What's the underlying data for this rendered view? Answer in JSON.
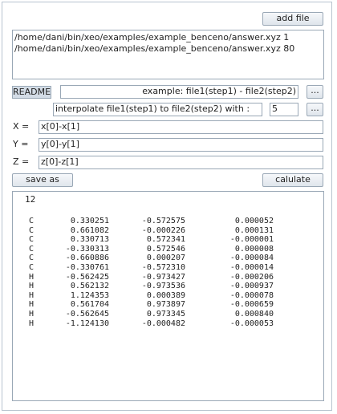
{
  "buttons": {
    "add_file": "add file",
    "readme": "README",
    "browse1": "...",
    "browse2": "...",
    "save_as": "save as",
    "calculate": "calulate"
  },
  "files": [
    "/home/dani/bin/xeo/examples/example_benceno/answer.xyz 1",
    "/home/dani/bin/xeo/examples/example_benceno/answer.xyz 80"
  ],
  "example_field": "example:  file1(step1) - file2(step2)",
  "interpolate_label": "interpolate   file1(step1) to file2(step2) with :",
  "interpolate_value": "5",
  "expressions": {
    "x_label": "X =",
    "x_value": "x[0]-x[1]",
    "y_label": "Y =",
    "y_value": "y[0]-y[1]",
    "z_label": "Z =",
    "z_value": "z[0]-z[1]"
  },
  "output": {
    "count": "12",
    "atoms": [
      {
        "el": "C",
        "x": "0.330251",
        "y": "-0.572575",
        "z": "0.000052"
      },
      {
        "el": "C",
        "x": "0.661082",
        "y": "-0.000226",
        "z": "0.000131"
      },
      {
        "el": "C",
        "x": "0.330713",
        "y": "0.572341",
        "z": "-0.000001"
      },
      {
        "el": "C",
        "x": "-0.330313",
        "y": "0.572546",
        "z": "0.000008"
      },
      {
        "el": "C",
        "x": "-0.660886",
        "y": "0.000207",
        "z": "-0.000084"
      },
      {
        "el": "C",
        "x": "-0.330761",
        "y": "-0.572310",
        "z": "-0.000014"
      },
      {
        "el": "H",
        "x": "-0.562425",
        "y": "-0.973427",
        "z": "-0.000206"
      },
      {
        "el": "H",
        "x": "0.562132",
        "y": "-0.973536",
        "z": "-0.000937"
      },
      {
        "el": "H",
        "x": "1.124353",
        "y": "0.000389",
        "z": "-0.000078"
      },
      {
        "el": "H",
        "x": "0.561704",
        "y": "0.973897",
        "z": "-0.000659"
      },
      {
        "el": "H",
        "x": "-0.562645",
        "y": "0.973345",
        "z": "0.000840"
      },
      {
        "el": "H",
        "x": "-1.124130",
        "y": "-0.000482",
        "z": "-0.000053"
      }
    ]
  }
}
